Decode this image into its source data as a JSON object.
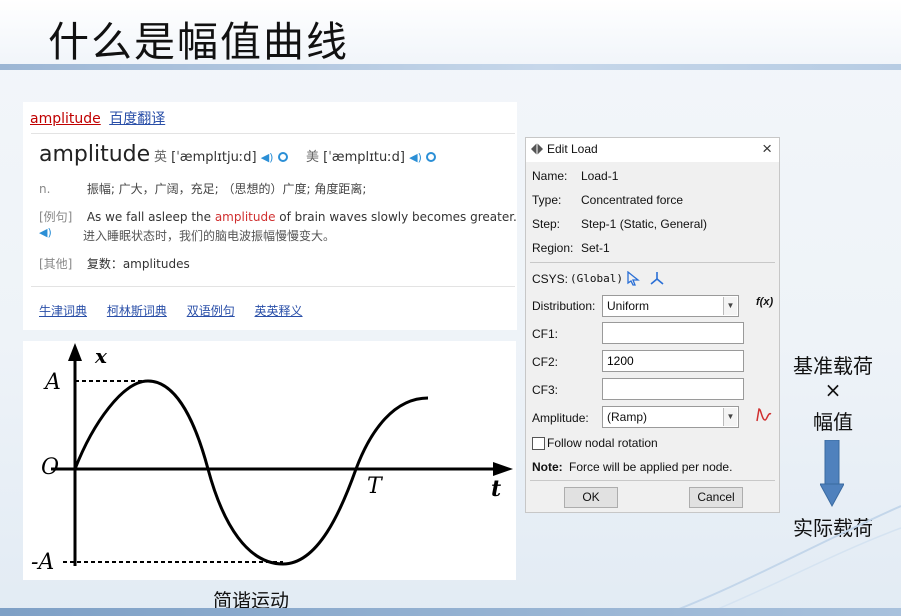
{
  "slide": {
    "title": "什么是幅值曲线",
    "caption": "简谐运动",
    "annotations": {
      "base_load": "基准载荷",
      "times": "×",
      "amplitude": "幅值",
      "actual_load": "实际载荷"
    }
  },
  "dictionary": {
    "head_word": "amplitude",
    "head_link": "百度翻译",
    "word": "amplitude",
    "uk_label": "英",
    "uk_phonetic": "[ˈæmplɪtjuːd]",
    "us_label": "美",
    "us_phonetic": "[ˈæmplɪtuːd]",
    "pos": "n.",
    "definition": "振幅; 广大，广阔，充足; （思想的）广度; 角度距离;",
    "example_tag": "[例句]",
    "example_before": "As we fall asleep the ",
    "example_highlight": "amplitude",
    "example_after": " of brain waves slowly becomes greater.",
    "example_translation": "进入睡眠状态时，我们的脑电波振幅慢慢变大。",
    "other_tag": "[其他]",
    "other_text": "复数：amplitudes",
    "footer_links": [
      "牛津词典",
      "柯林斯词典",
      "双语例句",
      "英英释义"
    ]
  },
  "graph": {
    "y_axis": "x",
    "x_axis": "t",
    "amp_pos": "A",
    "amp_neg": "-A",
    "origin": "O",
    "period": "T"
  },
  "dialog": {
    "title": "Edit Load",
    "name_label": "Name:",
    "name_value": "Load-1",
    "type_label": "Type:",
    "type_value": "Concentrated force",
    "step_label": "Step:",
    "step_value": "Step-1 (Static, General)",
    "region_label": "Region:",
    "region_value": "Set-1",
    "csys_label": "CSYS:",
    "csys_value": "(Global)",
    "distribution_label": "Distribution:",
    "distribution_value": "Uniform",
    "fx_label": "f(x)",
    "cf1_label": "CF1:",
    "cf1_value": "",
    "cf2_label": "CF2:",
    "cf2_value": "1200",
    "cf3_label": "CF3:",
    "cf3_value": "",
    "amplitude_label": "Amplitude:",
    "amplitude_value": "(Ramp)",
    "follow_label": "Follow nodal rotation",
    "note_label": "Note:",
    "note_text": "Force will be applied per node.",
    "ok_label": "OK",
    "cancel_label": "Cancel"
  },
  "colors": {
    "accent": "#4f81bd",
    "highlight": "#d03030",
    "link": "#2a4fa8"
  }
}
